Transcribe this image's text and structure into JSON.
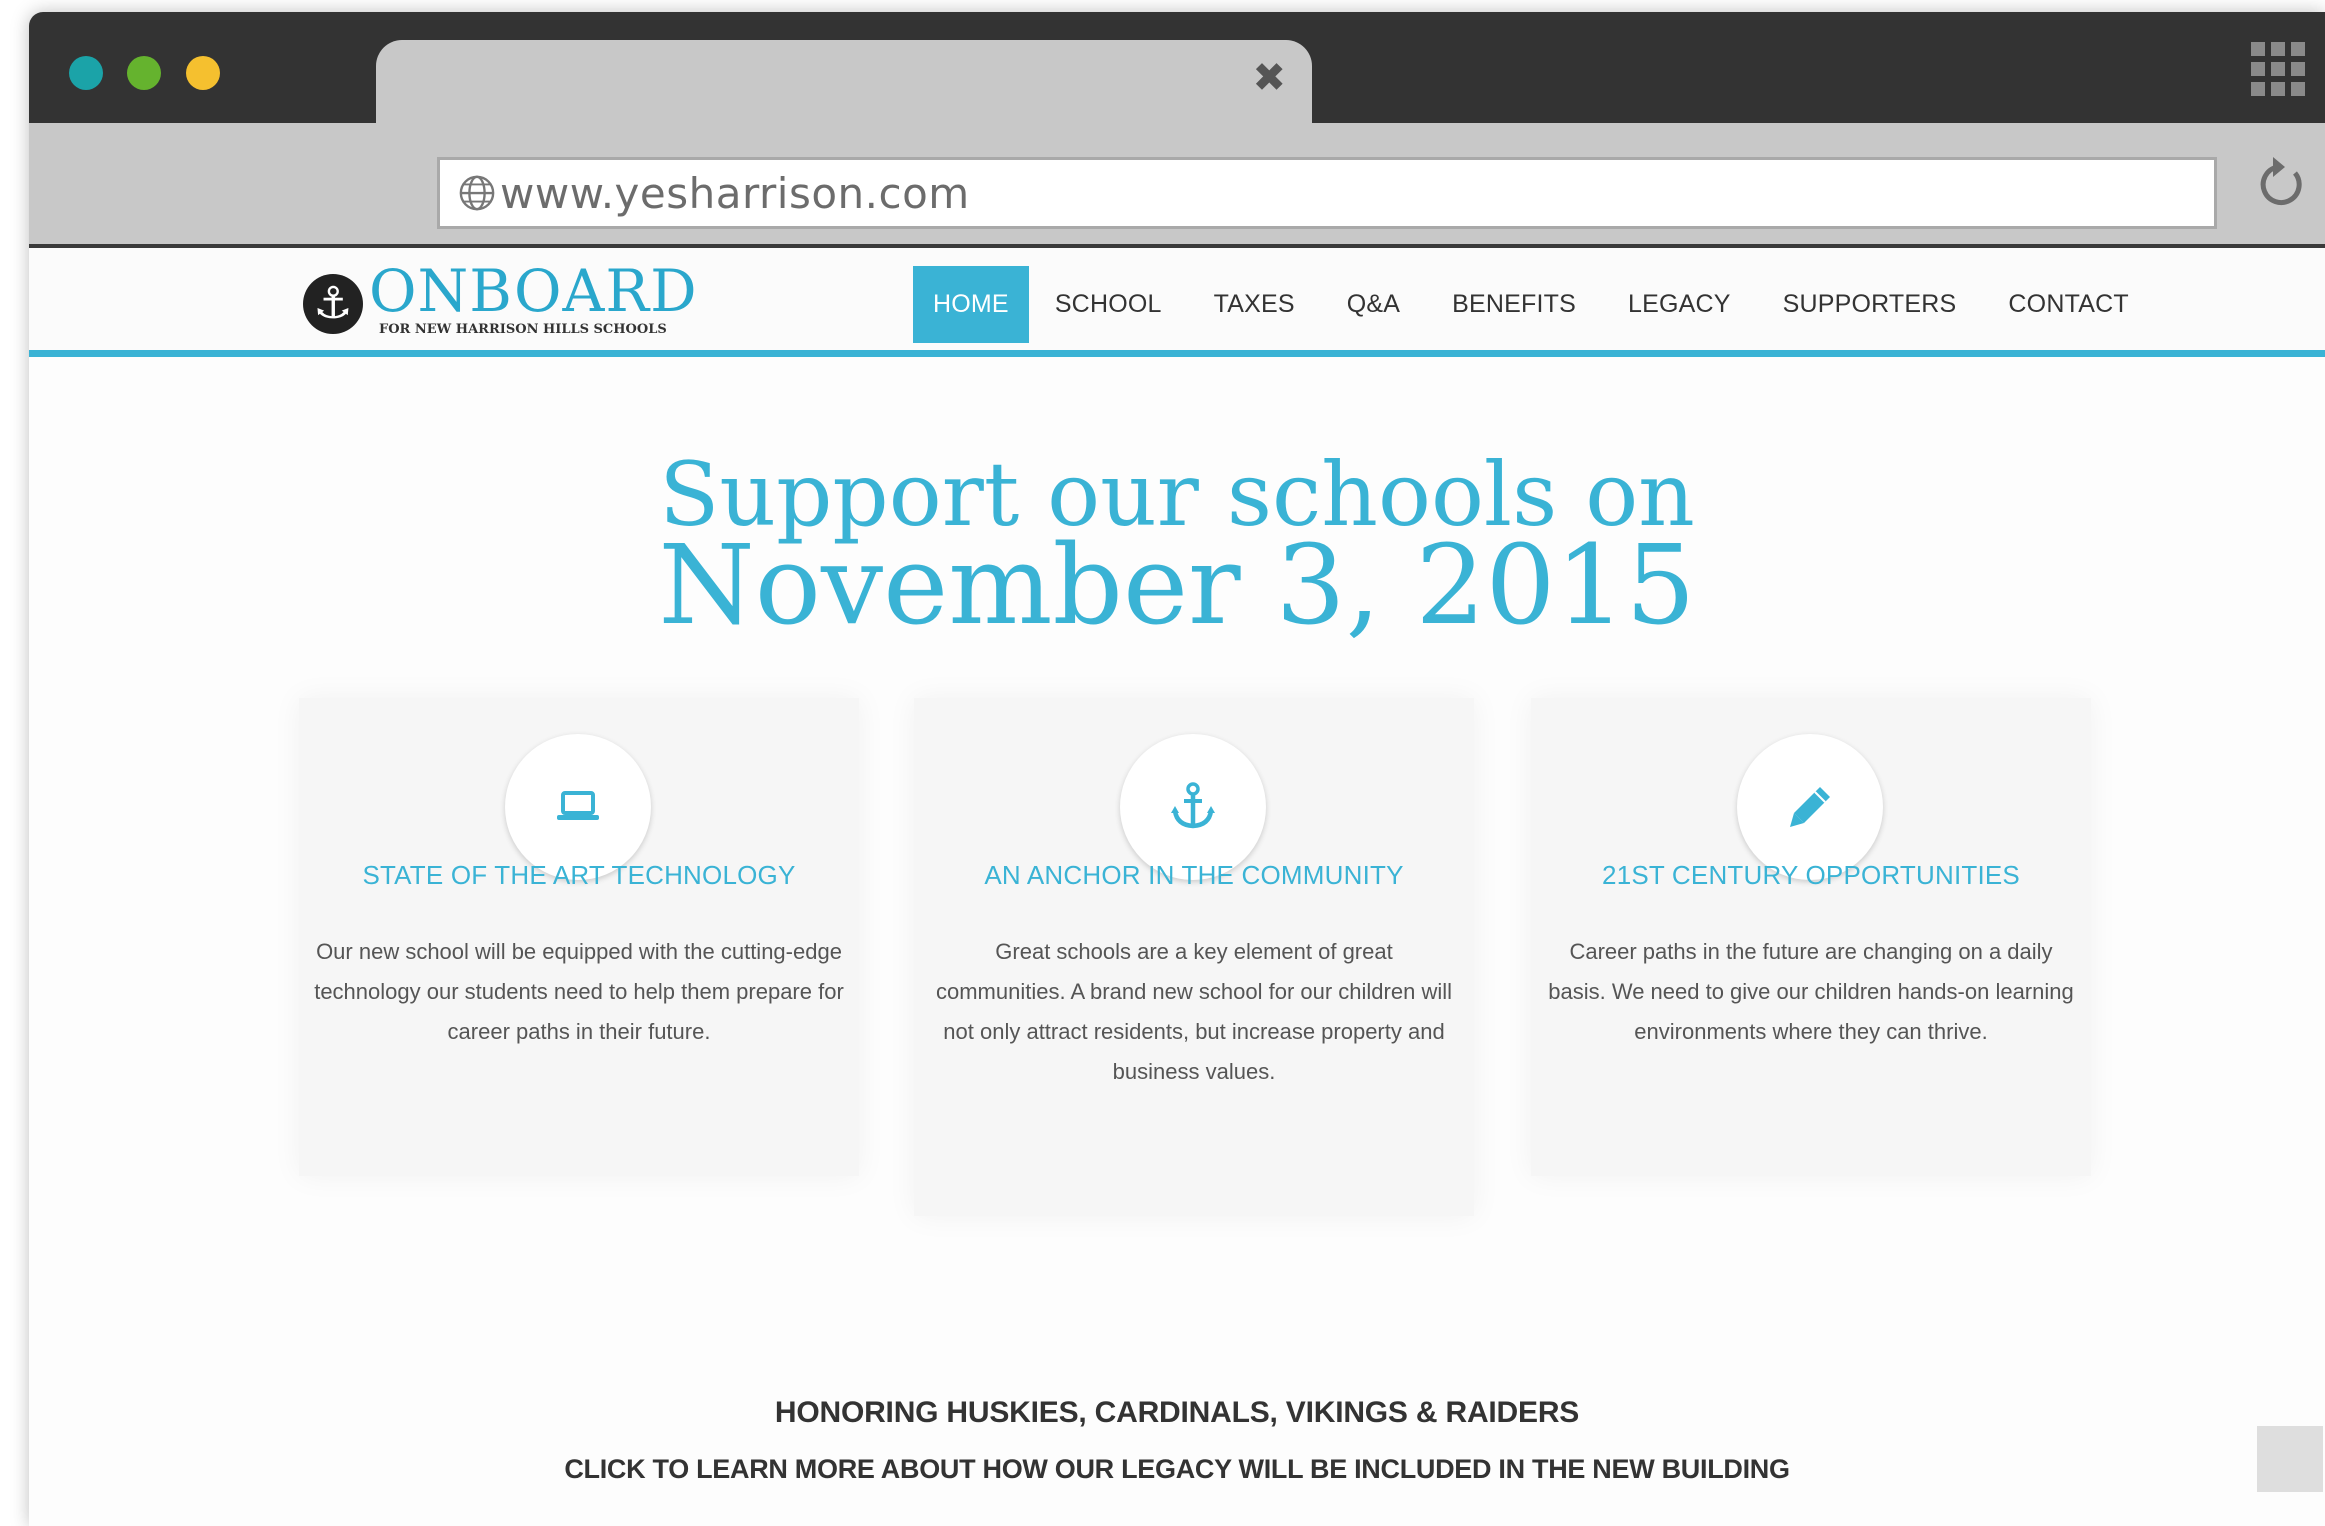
{
  "browser": {
    "url": "www.yesharrison.com",
    "tab_close_glyph": "✖"
  },
  "site": {
    "logo": {
      "word": "ONBOARD",
      "subtitle": "FOR NEW HARRISON HILLS SCHOOLS",
      "anchor_glyph": "⚓"
    },
    "nav": [
      {
        "label": "HOME",
        "active": true
      },
      {
        "label": "SCHOOL"
      },
      {
        "label": "TAXES"
      },
      {
        "label": "Q&A"
      },
      {
        "label": "BENEFITS"
      },
      {
        "label": "LEGACY"
      },
      {
        "label": "SUPPORTERS"
      },
      {
        "label": "CONTACT"
      }
    ],
    "hero": {
      "line1": "Support our schools on",
      "line2": "November 3, 2015"
    },
    "cards": [
      {
        "icon": "laptop-icon",
        "title": "STATE OF THE ART TECHNOLOGY",
        "text": "Our new school will be equipped with the cutting-edge technology our students need to help them prepare for career paths in their future."
      },
      {
        "icon": "anchor-icon",
        "title": "AN ANCHOR IN THE COMMUNITY",
        "text": "Great schools are a key element of great communities. A brand new school for our children will not only attract residents, but increase property and business values."
      },
      {
        "icon": "pencil-icon",
        "title": "21ST CENTURY OPPORTUNITIES",
        "text": "Career paths in the future are changing on a daily basis. We need to give our children hands-on learning environments where they can thrive."
      }
    ],
    "honor_heading": "HONORING HUSKIES, CARDINALS, VIKINGS & RAIDERS",
    "legacy_link": "CLICK TO LEARN MORE ABOUT HOW OUR LEGACY WILL BE INCLUDED IN THE NEW BUILDING"
  },
  "colors": {
    "accent": "#3ab3d5",
    "titlebar": "#333333",
    "toolbar": "#c8c8c8"
  }
}
